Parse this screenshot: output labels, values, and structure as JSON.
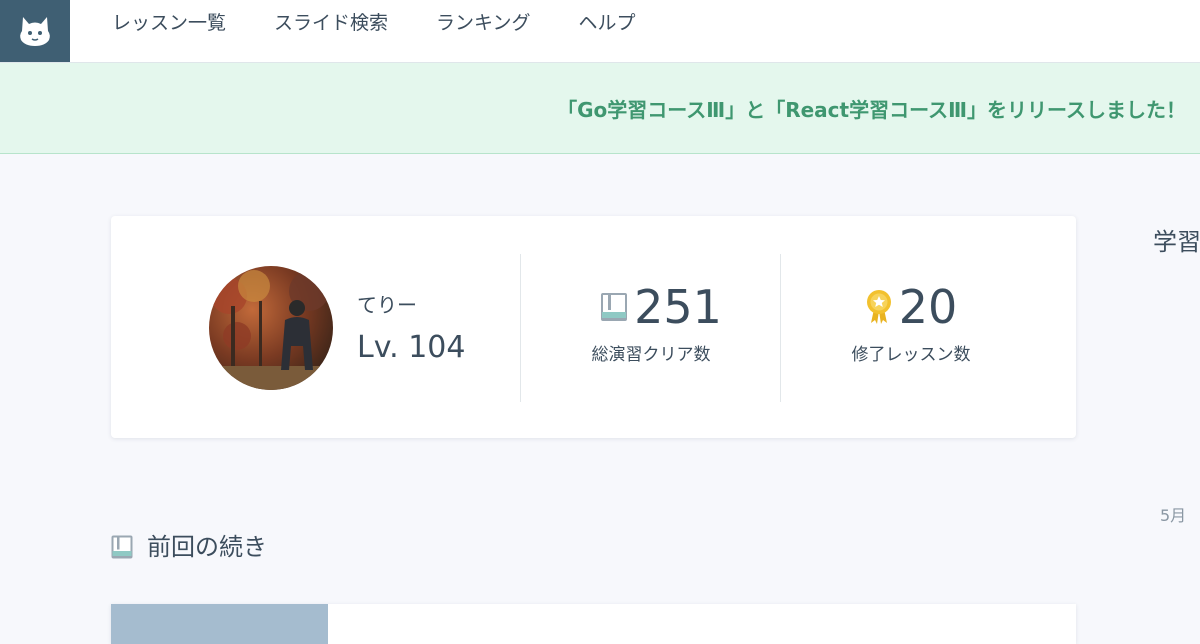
{
  "nav": {
    "items": [
      {
        "label": "レッスン一覧"
      },
      {
        "label": "スライド検索"
      },
      {
        "label": "ランキング"
      },
      {
        "label": "ヘルプ"
      }
    ]
  },
  "banner": {
    "text": "「Go学習コースⅢ」と「React学習コースⅢ」をリリースしました！"
  },
  "profile": {
    "name": "てりー",
    "level": "Lv. 104"
  },
  "stats": {
    "exercises_cleared": {
      "value": "251",
      "label": "総演習クリア数",
      "icon": "book-icon"
    },
    "lessons_completed": {
      "value": "20",
      "label": "修了レッスン数",
      "icon": "medal-icon"
    }
  },
  "side": {
    "heading": "学習",
    "month": "5月"
  },
  "continue_section": {
    "title": "前回の続き",
    "icon": "book-icon"
  },
  "colors": {
    "header_logo_bg": "#3f5f73",
    "banner_bg": "#e4f7ed",
    "banner_text": "#3f9770",
    "text_primary": "#3c4d5d",
    "medal_gold": "#f2c12e"
  }
}
